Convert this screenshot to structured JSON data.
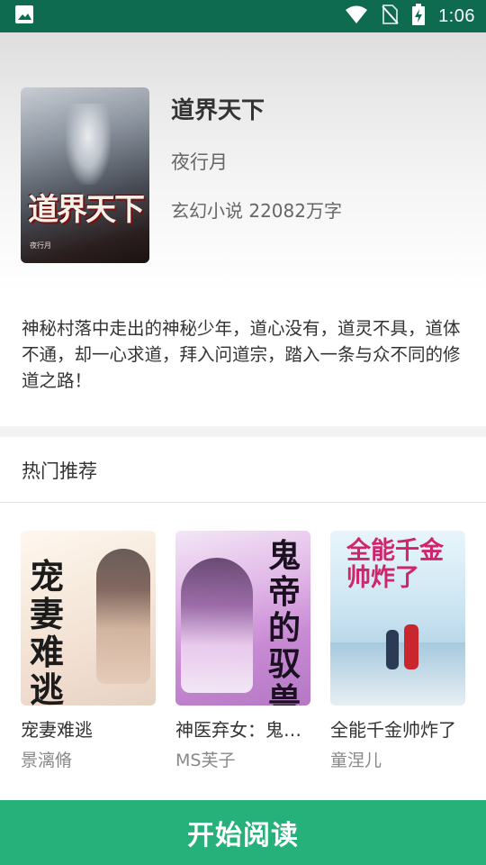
{
  "status_bar": {
    "time": "1:06",
    "icons": [
      "image-icon",
      "wifi-icon",
      "no-sim-icon",
      "battery-charging-icon"
    ]
  },
  "book": {
    "title": "道界天下",
    "author": "夜行月",
    "meta": "玄幻小说 22082万字",
    "cover_title_art": "道界天下",
    "cover_author_art": "夜行月",
    "description": " 神秘村落中走出的神秘少年，道心没有，道灵不具，道体不通，却一心求道，拜入问道宗，踏入一条与众不同的修道之路！"
  },
  "section": {
    "title": "热门推荐"
  },
  "recommendations": [
    {
      "title": "宠妻难逃",
      "author": "景漓脩",
      "cover_text": "宠妻难逃"
    },
    {
      "title": "神医弃女：鬼帝的驭兽狂妃",
      "author": "MS芙子",
      "cover_text": "鬼帝的驭兽狂妃"
    },
    {
      "title": "全能千金帅炸了",
      "author": "童涅儿",
      "cover_text": "全能千金帅炸了"
    }
  ],
  "actions": {
    "start_reading": "开始阅读"
  },
  "colors": {
    "status_bar": "#0f6b50",
    "primary": "#26b07a"
  }
}
